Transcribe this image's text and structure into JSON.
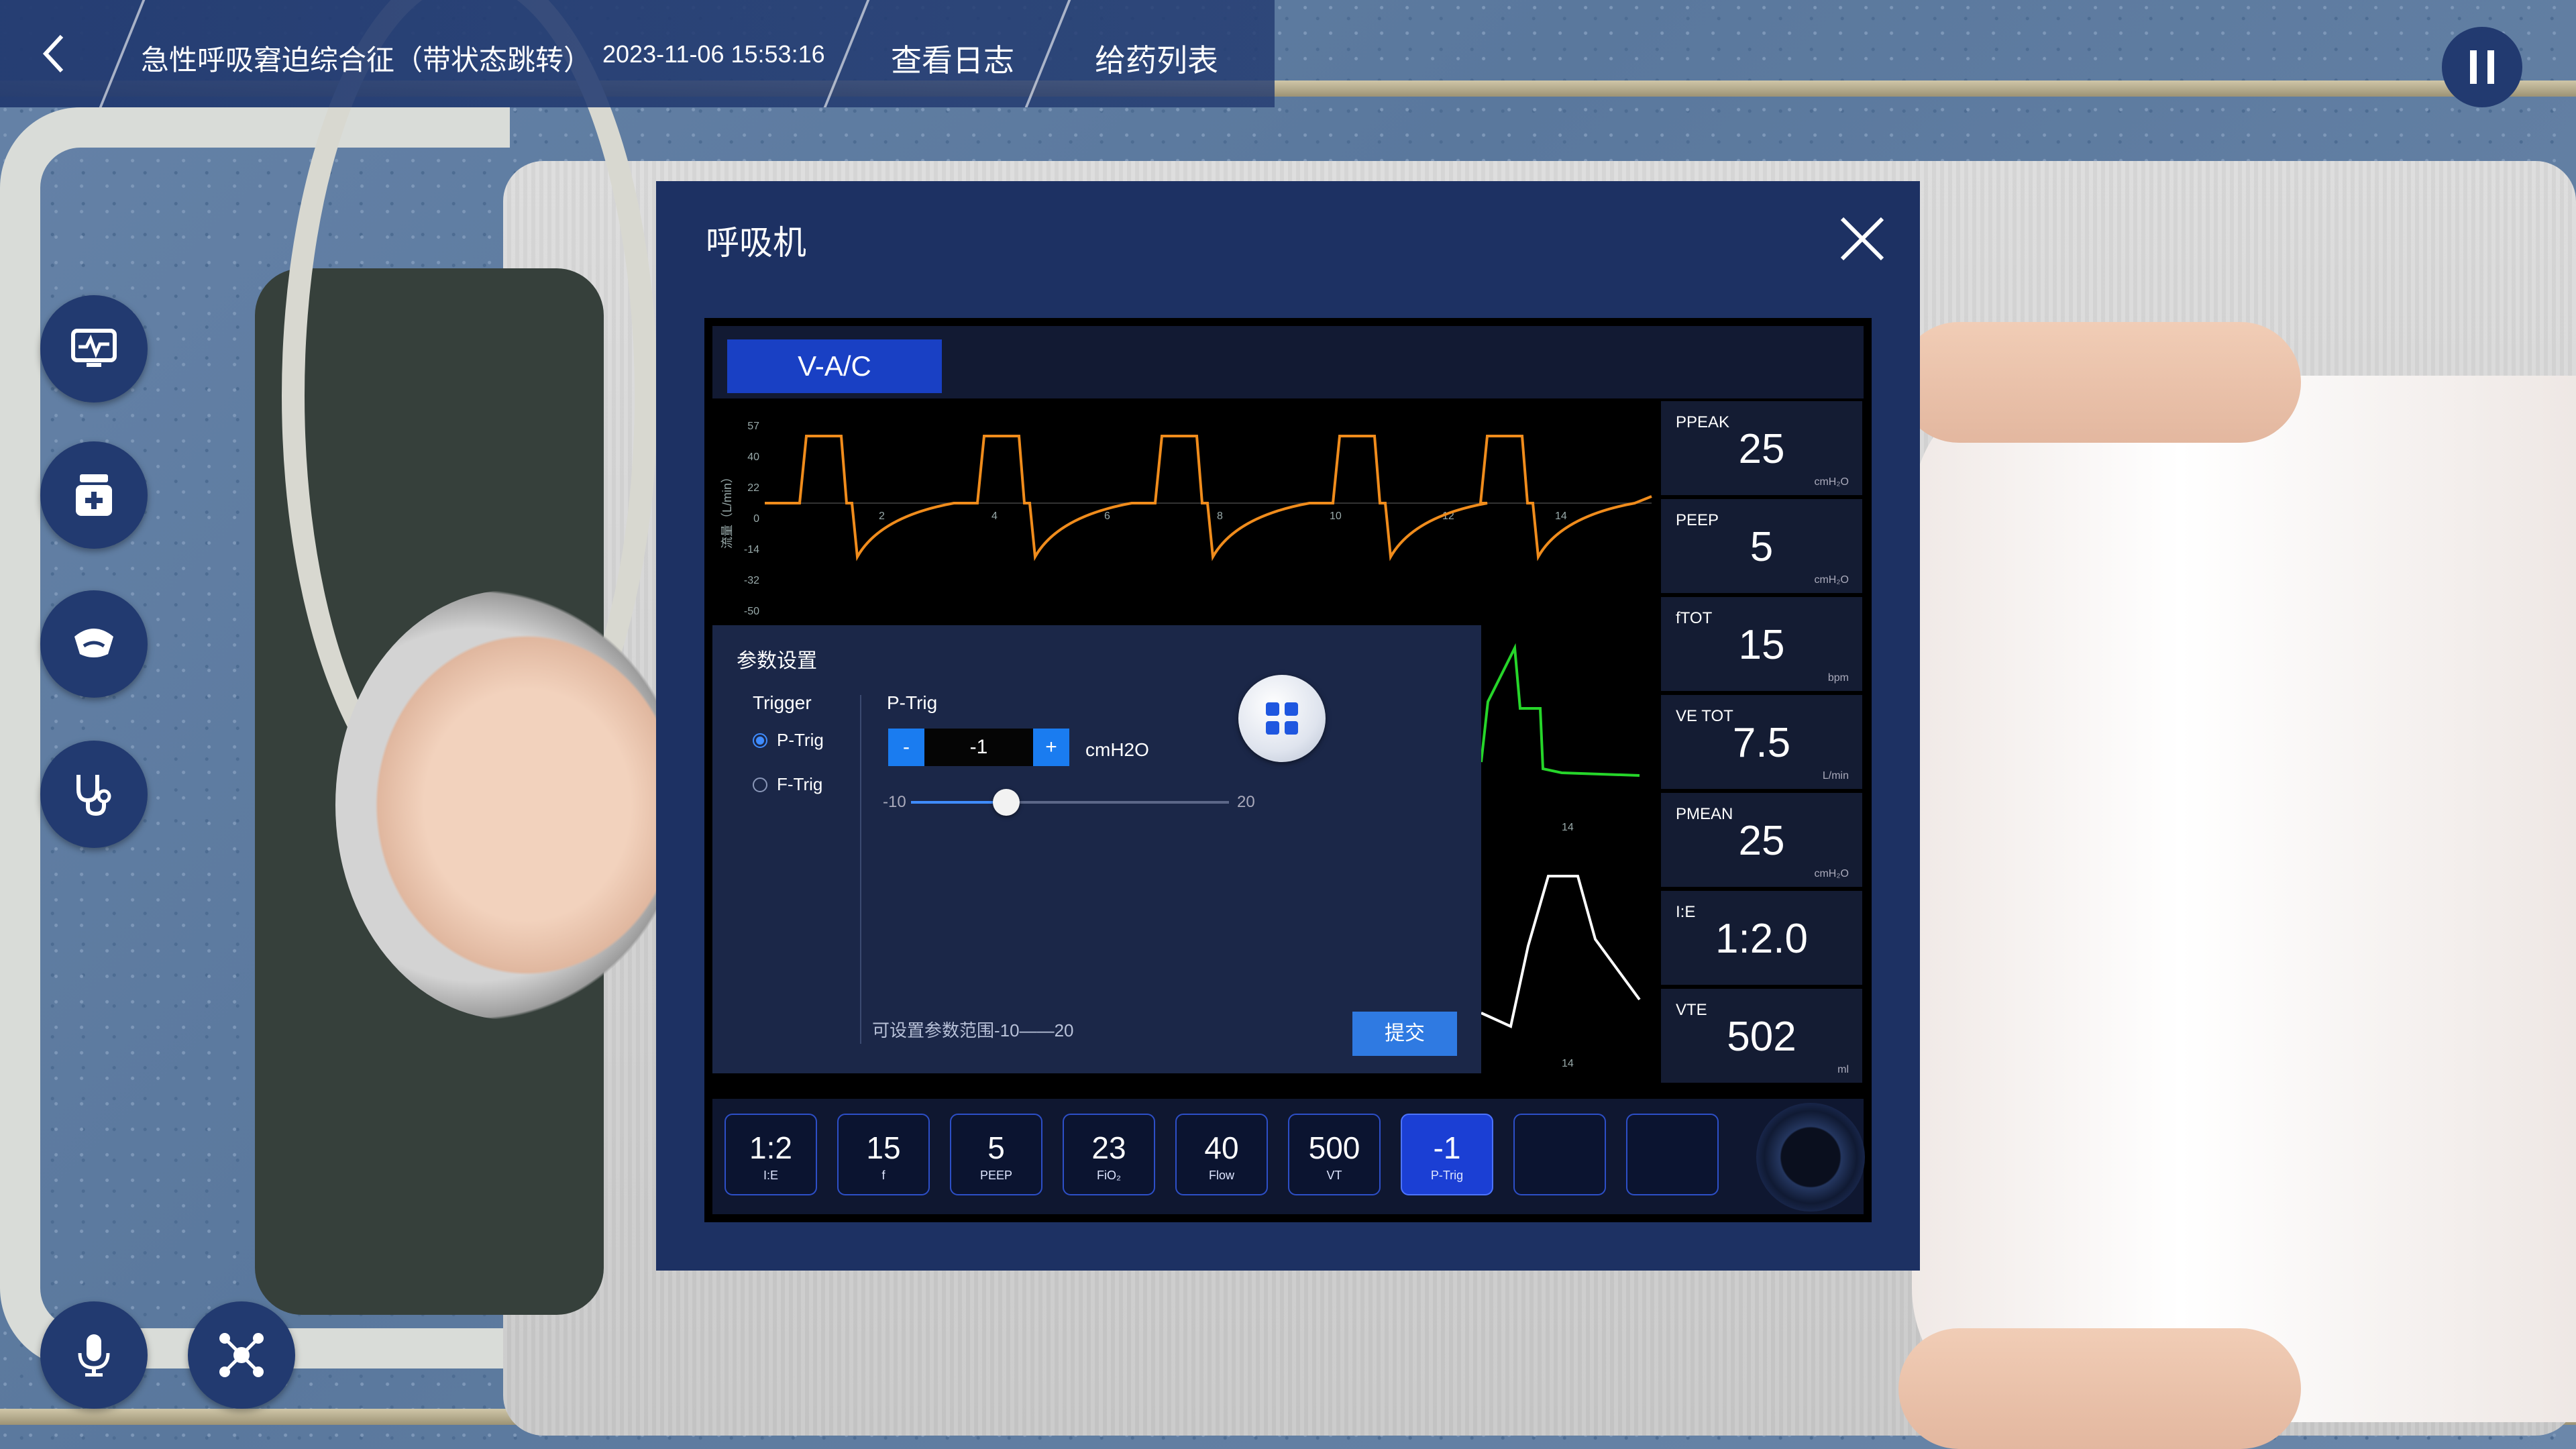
{
  "header": {
    "title": "急性呼吸窘迫综合征（带状态跳转）",
    "timestamp": "2023-11-06 15:53:16",
    "nav": [
      "查看日志",
      "给药列表"
    ]
  },
  "left_tools": [
    "monitor-icon",
    "medicine-icon",
    "ultrasound-icon",
    "stethoscope-icon"
  ],
  "bottom_tools": [
    "microphone-icon",
    "network-icon"
  ],
  "dialog": {
    "title": "呼吸机",
    "mode": "V-A/C",
    "flow_axis": {
      "label": "流量（L/min）",
      "ticks": [
        "57",
        "40",
        "22",
        "0",
        "-14",
        "-32",
        "-50"
      ],
      "x_ticks": [
        "2",
        "4",
        "6",
        "8",
        "10",
        "12",
        "14"
      ]
    },
    "mid_axis_tick": "14",
    "low_axis_tick": "14",
    "params": [
      {
        "label": "PPEAK",
        "value": "25",
        "unit": "cmH₂O"
      },
      {
        "label": "PEEP",
        "value": "5",
        "unit": "cmH₂O"
      },
      {
        "label": "fTOT",
        "value": "15",
        "unit": "bpm"
      },
      {
        "label": "VE TOT",
        "value": "7.5",
        "unit": "L/min"
      },
      {
        "label": "PMEAN",
        "value": "25",
        "unit": "cmH₂O"
      },
      {
        "label": "I:E",
        "value": "1:2.0",
        "unit": ""
      },
      {
        "label": "VTE",
        "value": "502",
        "unit": "ml"
      }
    ],
    "settings": {
      "title": "参数设置",
      "trigger_label": "Trigger",
      "options": [
        "P-Trig",
        "F-Trig"
      ],
      "selected_option": "P-Trig",
      "field_label": "P-Trig",
      "minus": "-",
      "plus": "+",
      "value": "-1",
      "unit": "cmH2O",
      "slider_min": "-10",
      "slider_max": "20",
      "slider_value": -1,
      "range_note": "可设置参数范围-10——20",
      "submit": "提交"
    },
    "keys": [
      {
        "value": "1:2",
        "label": "I:E",
        "active": false
      },
      {
        "value": "15",
        "label": "f",
        "active": false
      },
      {
        "value": "5",
        "label": "PEEP",
        "active": false
      },
      {
        "value": "23",
        "label": "FiO₂",
        "active": false
      },
      {
        "value": "40",
        "label": "Flow",
        "active": false
      },
      {
        "value": "500",
        "label": "VT",
        "active": false
      },
      {
        "value": "-1",
        "label": "P-Trig",
        "active": true
      },
      {
        "value": "",
        "label": "",
        "active": false
      },
      {
        "value": "",
        "label": "",
        "active": false
      }
    ]
  },
  "colors": {
    "flow_wave": "#f08c1c",
    "pressure_wave": "#26d62a",
    "volume_wave": "#ffffff",
    "panel_bg": "#1d3163",
    "accent": "#1940c4"
  }
}
